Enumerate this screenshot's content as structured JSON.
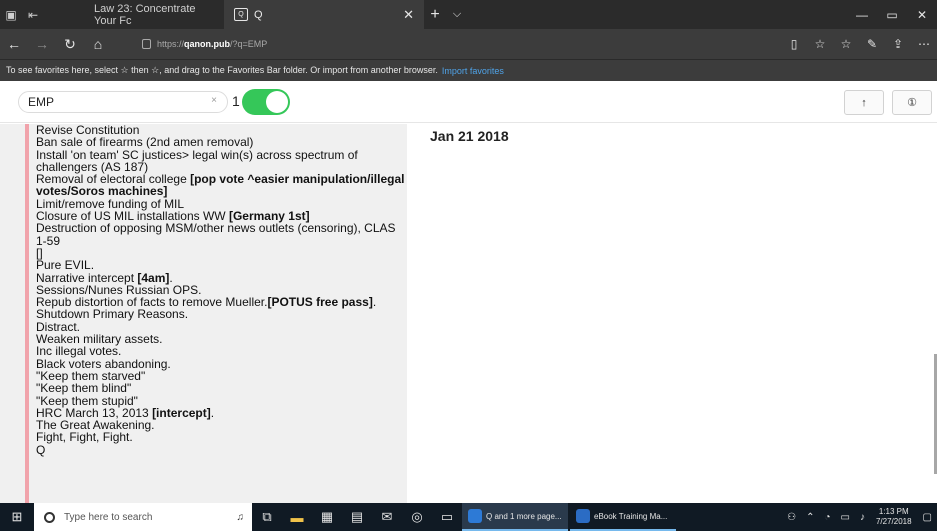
{
  "browser": {
    "tabs": [
      {
        "label": "Law 23: Concentrate Your Fc",
        "active": false
      },
      {
        "label": "Q",
        "active": true
      }
    ],
    "new_tab_glyph": "+",
    "tab_menu_glyph": "⌵",
    "close_glyph": "✕",
    "url_prefix": "https://",
    "url_host": "qanon.pub",
    "url_path": "/?q=EMP",
    "favorites_hint": "To see favorites here, select ☆ then ☆, and drag to the Favorites Bar folder. Or import from another browser.",
    "favorites_link": "Import favorites"
  },
  "search": {
    "query": "EMP",
    "clear_glyph": "×",
    "result_count": "1",
    "toggle_on": true
  },
  "toolbar": {
    "up_glyph": "↑",
    "info_glyph": "①"
  },
  "post": {
    "date": "Jan 21 2018",
    "lines": [
      {
        "text": "Revise Constitution",
        "bold": false
      },
      {
        "text": "Ban sale of firearms (2nd amen removal)",
        "bold": false
      },
      {
        "text": "Install 'on team' SC justices> legal win(s) across spectrum of challengers (AS 187)",
        "bold": false
      },
      {
        "text": "Removal of electoral college ",
        "bold": false,
        "bold_tail": "[pop vote ^easier manipulation/illegal votes/Soros machines]"
      },
      {
        "text": "Limit/remove funding of MIL",
        "bold": false
      },
      {
        "text": "Closure of US MIL installations WW ",
        "bold": false,
        "bold_tail": "[Germany 1st]"
      },
      {
        "text": "Destruction of opposing MSM/other news outlets (censoring), CLAS 1-59",
        "bold": false
      },
      {
        "text": "[]",
        "bold": false
      },
      {
        "text": "Pure EVIL.",
        "bold": false
      },
      {
        "text": "Narrative intercept ",
        "bold": false,
        "bold_tail": "[4am]",
        "tail": "."
      },
      {
        "text": "Sessions/Nunes Russian OPS.",
        "bold": false
      },
      {
        "text": "Repub distortion of facts to remove Mueller.",
        "bold": false,
        "bold_tail": "[POTUS free pass]",
        "tail": "."
      },
      {
        "text": "Shutdown Primary Reasons.",
        "bold": false
      },
      {
        "text": "Distract.",
        "bold": false
      },
      {
        "text": "Weaken military assets.",
        "bold": false
      },
      {
        "text": "Inc illegal votes.",
        "bold": false
      },
      {
        "text": "Black voters abandoning.",
        "bold": false
      },
      {
        "text": "\"Keep them starved\"",
        "bold": false
      },
      {
        "text": "\"Keep them blind\"",
        "bold": false
      },
      {
        "text": "\"Keep them stupid\"",
        "bold": false
      },
      {
        "text": "HRC March 13, 2013 ",
        "bold": false,
        "bold_tail": "[intercept]",
        "tail": "."
      },
      {
        "text": "The Great Awakening.",
        "bold": false
      },
      {
        "text": "Fight, Fight, Fight.",
        "bold": false
      },
      {
        "text": "Q",
        "bold": false
      }
    ]
  },
  "taskbar": {
    "search_placeholder": "Type here to search",
    "apps": [
      {
        "label": "Q and 1 more page...",
        "color": "#2d7ad6"
      },
      {
        "label": "eBook Training Ma...",
        "color": "#2b6cc4"
      }
    ],
    "time": "1:13 PM",
    "date": "7/27/2018"
  },
  "colors": {
    "accent_toggle": "#35c759",
    "post_border": "#f1a3ab",
    "link": "#4fa3e8"
  }
}
